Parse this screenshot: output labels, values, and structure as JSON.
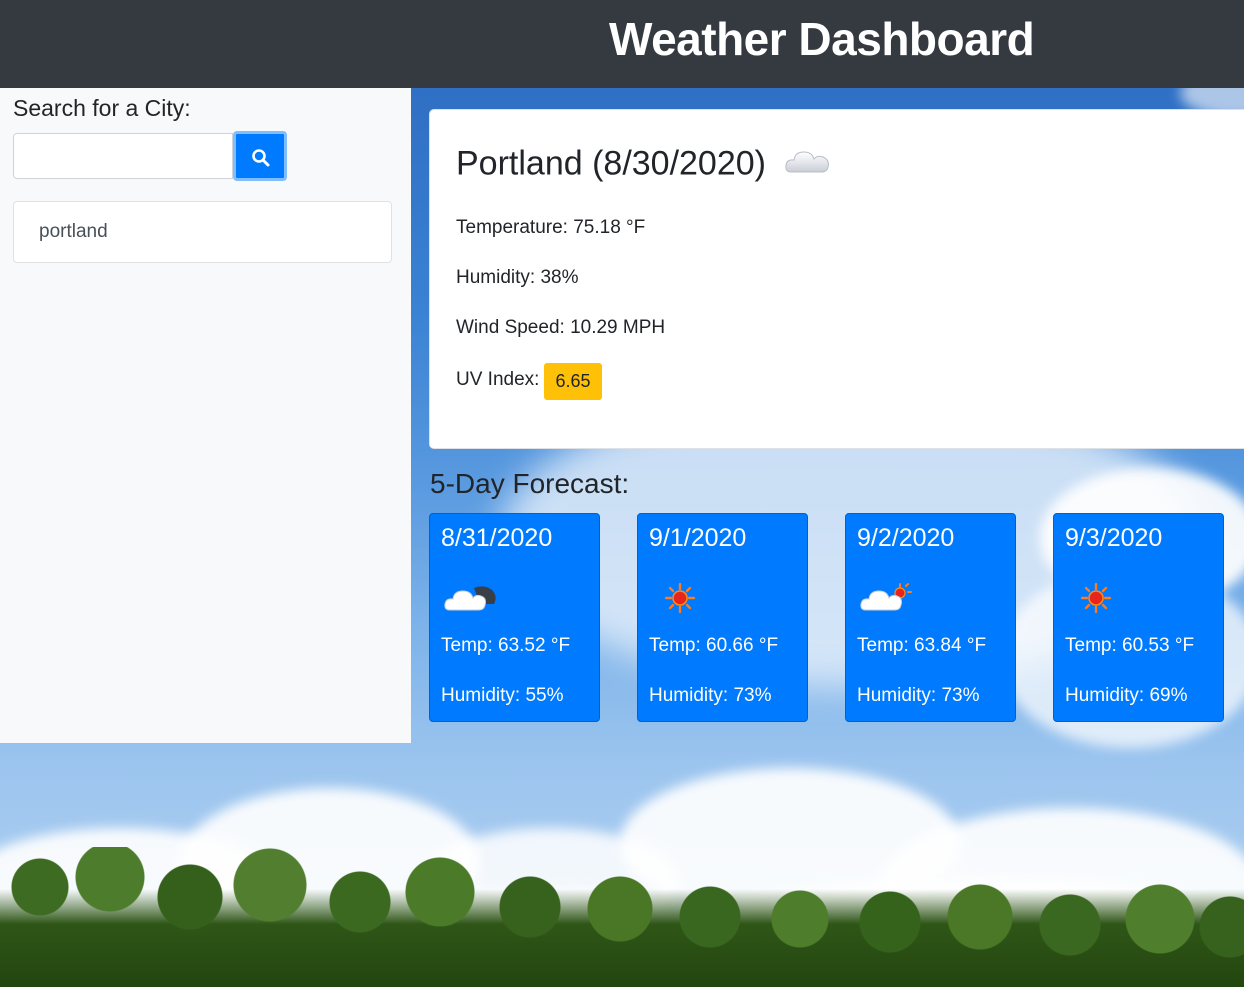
{
  "header": {
    "title": "Weather Dashboard"
  },
  "sidebar": {
    "search_label": "Search for a City:",
    "search_placeholder": "",
    "search_value": "",
    "search_button_icon": "search-icon",
    "history": [
      "portland"
    ]
  },
  "current": {
    "title": "Portland (8/30/2020)",
    "icon": "cloud-icon",
    "temperature": "Temperature: 75.18 °F",
    "humidity": "Humidity: 38%",
    "wind": "Wind Speed: 10.29 MPH",
    "uv_label": "UV Index:",
    "uv_value": "6.65",
    "uv_color": "#ffc107"
  },
  "forecast": {
    "title": "5-Day Forecast:",
    "days": [
      {
        "date": "8/31/2020",
        "icon": "cloud-moon-icon",
        "temp": "Temp: 63.52 °F",
        "humidity": "Humidity: 55%"
      },
      {
        "date": "9/1/2020",
        "icon": "sun-icon",
        "temp": "Temp: 60.66 °F",
        "humidity": "Humidity: 73%"
      },
      {
        "date": "9/2/2020",
        "icon": "cloud-sun-icon",
        "temp": "Temp: 63.84 °F",
        "humidity": "Humidity: 73%"
      },
      {
        "date": "9/3/2020",
        "icon": "sun-icon",
        "temp": "Temp: 60.53 °F",
        "humidity": "Humidity: 69%"
      }
    ]
  },
  "colors": {
    "header_bg": "#343a40",
    "primary": "#007bff",
    "uv_warning": "#ffc107"
  }
}
